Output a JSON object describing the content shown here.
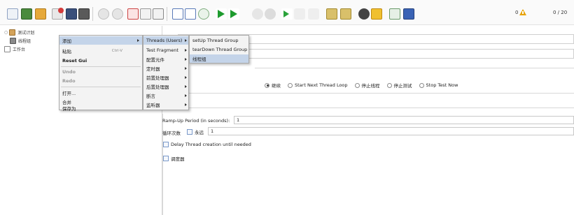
{
  "status": {
    "warning_count": "0",
    "threads_ratio": "0 / 20"
  },
  "tree": {
    "root_label": "测试计划",
    "child_label": "线程组",
    "workbench_label": "工作台"
  },
  "menu_main": {
    "items": [
      {
        "label": "添加"
      },
      {
        "label": "粘贴",
        "shortcut": "Ctrl-V"
      },
      {
        "label": "Reset Gui"
      },
      {
        "label": "Undo"
      },
      {
        "label": "Redo"
      },
      {
        "label": "打开..."
      },
      {
        "label": "合并"
      },
      {
        "label": "保存为"
      }
    ]
  },
  "menu_sub": {
    "items": [
      {
        "label": "Threads (Users)"
      },
      {
        "label": "Test Fragment"
      },
      {
        "label": "配置元件"
      },
      {
        "label": "定时器"
      },
      {
        "label": "前置处理器"
      },
      {
        "label": "后置处理器"
      },
      {
        "label": "断言"
      },
      {
        "label": "监听器"
      }
    ]
  },
  "menu_threads": {
    "items": [
      {
        "label": "setUp Thread Group"
      },
      {
        "label": "tearDown Thread Group"
      },
      {
        "label": "线程组"
      }
    ]
  },
  "thread_group": {
    "on_error": {
      "options": [
        "继续",
        "Start Next Thread Loop",
        "停止线程",
        "停止测试",
        "Stop Test Now"
      ],
      "selected": "继续"
    },
    "ramp_up_label": "Ramp-Up Period (in seconds):",
    "ramp_up_value": "1",
    "loop_label": "循环次数",
    "forever_label": "永远",
    "loop_value": "1",
    "delay_label": "Delay Thread creation until needed",
    "scheduler_label": "调度器"
  },
  "colors": {
    "menu_bg": "#f3f3f3",
    "menu_selected": "#c4d4e9"
  }
}
